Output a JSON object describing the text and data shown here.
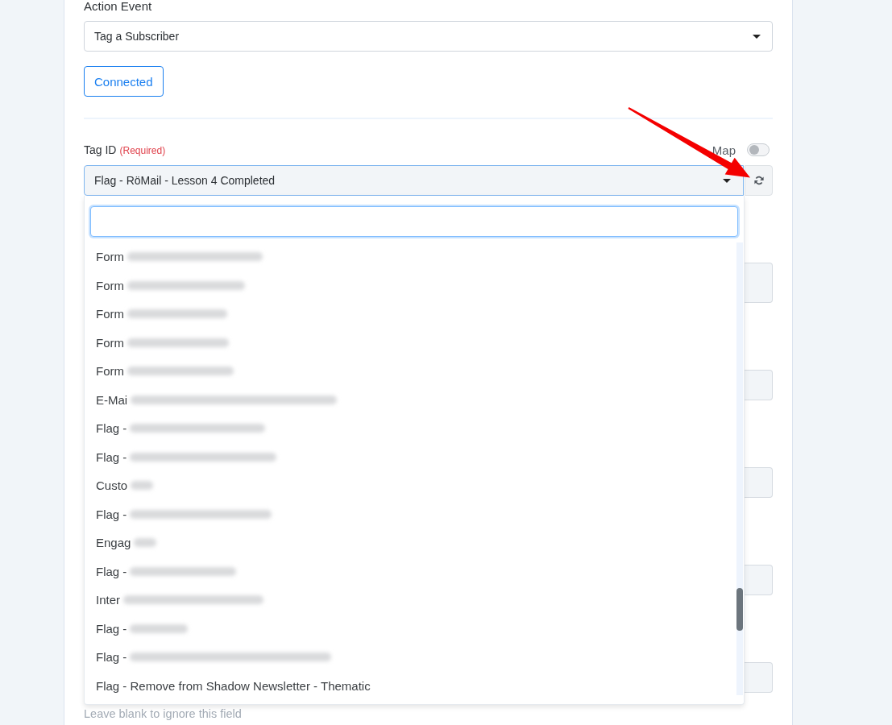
{
  "action_event": {
    "label": "Action Event",
    "value": "Tag a Subscriber"
  },
  "connection_button": {
    "label": "Connected"
  },
  "tag_id": {
    "label": "Tag ID",
    "required_note": "(Required)",
    "map_label": "Map",
    "map_toggle": {
      "on": false
    },
    "value": "Flag - RöMail - Lesson 4 Completed",
    "expanded": true,
    "search_field": {
      "focused": true
    },
    "options": [
      {
        "label": "Form",
        "redacted": true,
        "selected": false
      },
      {
        "label": "Form",
        "redacted": true,
        "selected": false
      },
      {
        "label": "Form",
        "redacted": true,
        "selected": false
      },
      {
        "label": "Form",
        "redacted": true,
        "selected": false
      },
      {
        "label": "Form",
        "redacted": true,
        "selected": false
      },
      {
        "label": "E-Mai",
        "redacted": true,
        "selected": false
      },
      {
        "label": "Flag -",
        "redacted": true,
        "selected": false
      },
      {
        "label": "Flag -",
        "redacted": true,
        "selected": false
      },
      {
        "label": "Custo",
        "redacted": true,
        "selected": false
      },
      {
        "label": "Flag -",
        "redacted": true,
        "selected": false
      },
      {
        "label": "Engag",
        "redacted": true,
        "selected": false
      },
      {
        "label": "Flag -",
        "redacted": true,
        "selected": false
      },
      {
        "label": "Inter",
        "redacted": true,
        "selected": false
      },
      {
        "label": "Flag -",
        "redacted": true,
        "selected": false
      },
      {
        "label": "Flag -",
        "redacted": true,
        "selected": false
      },
      {
        "label": "Flag - Remove from Shadow Newsletter - Thematic",
        "redacted": false,
        "selected": false
      }
    ],
    "hint": "Leave blank to ignore this field"
  }
}
